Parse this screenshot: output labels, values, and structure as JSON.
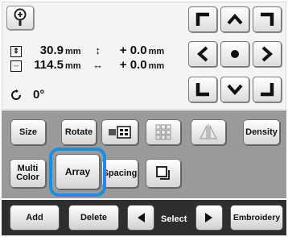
{
  "info": {
    "width_value": "30.9",
    "height_value": "114.5",
    "unit": "mm",
    "vshift_value": "+ 0.0",
    "hshift_value": "+ 0.0",
    "rotation_value": "0°"
  },
  "buttons": {
    "size": "Size",
    "rotate": "Rotate",
    "density": "Density",
    "multi_color_line1": "Multi",
    "multi_color_line2": "Color",
    "array": "Array",
    "spacing": "Spacing"
  },
  "bottom": {
    "add": "Add",
    "delete": "Delete",
    "select": "Select",
    "embroidery": "Embroidery"
  },
  "colors": {
    "highlight": "#1a8fe0",
    "mid_panel": "#9a9a9a",
    "bottom_bar": "#2e2e2e"
  }
}
